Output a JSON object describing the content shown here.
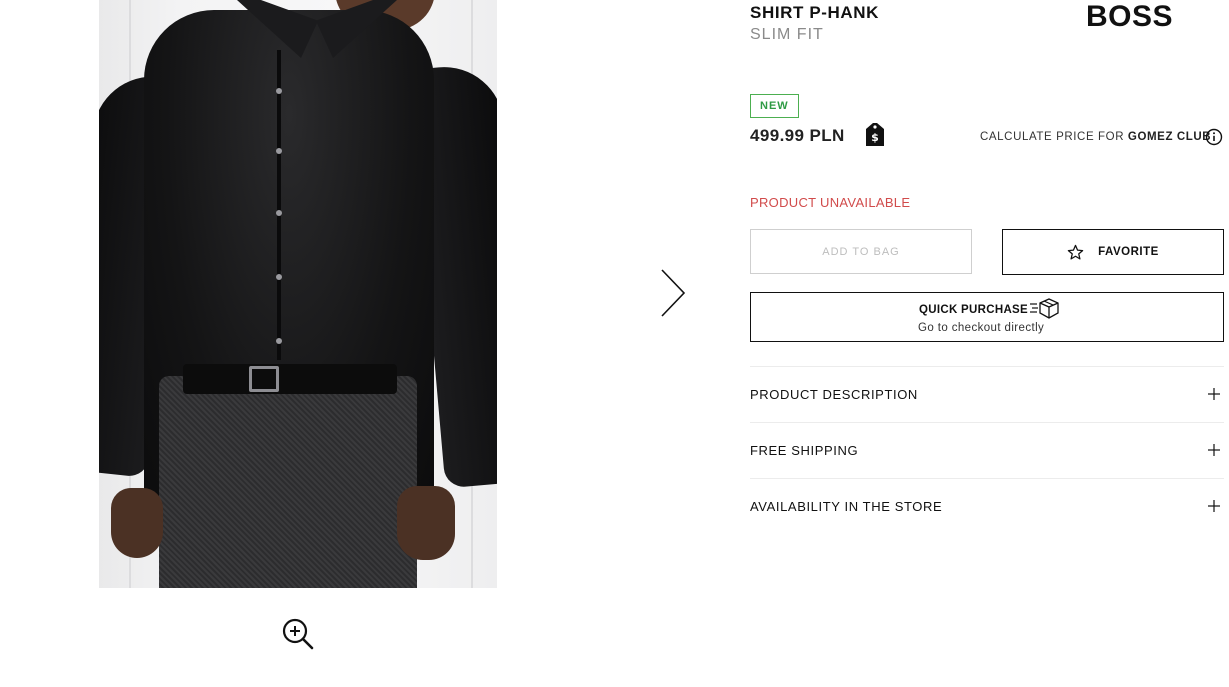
{
  "product": {
    "name": "SHIRT P-HANK",
    "fit": "SLIM FIT",
    "brand": "BOSS",
    "badge": "NEW",
    "price": "499.99 PLN",
    "calculate_prefix": "CALCULATE PRICE FOR",
    "calculate_club": "GOMEZ CLUB",
    "availability": "PRODUCT UNAVAILABLE"
  },
  "actions": {
    "add_to_bag": "ADD TO BAG",
    "favorite": "FAVORITE",
    "quick_purchase_title": "QUICK PURCHASE",
    "quick_purchase_sub": "Go to checkout directly"
  },
  "accordion": [
    {
      "label": "PRODUCT DESCRIPTION"
    },
    {
      "label": "FREE SHIPPING"
    },
    {
      "label": "AVAILABILITY IN THE STORE"
    }
  ],
  "icons": {
    "zoom": "zoom-in-icon",
    "next": "chevron-right-icon",
    "price_tag": "price-tag-icon",
    "info": "info-icon",
    "favorite": "star-icon",
    "quick": "delivery-box-icon",
    "expand": "plus-icon"
  },
  "colors": {
    "new_badge": "#2e9b44",
    "unavailable": "#d14b4b",
    "text": "#111111",
    "muted": "#8a8a8a"
  }
}
